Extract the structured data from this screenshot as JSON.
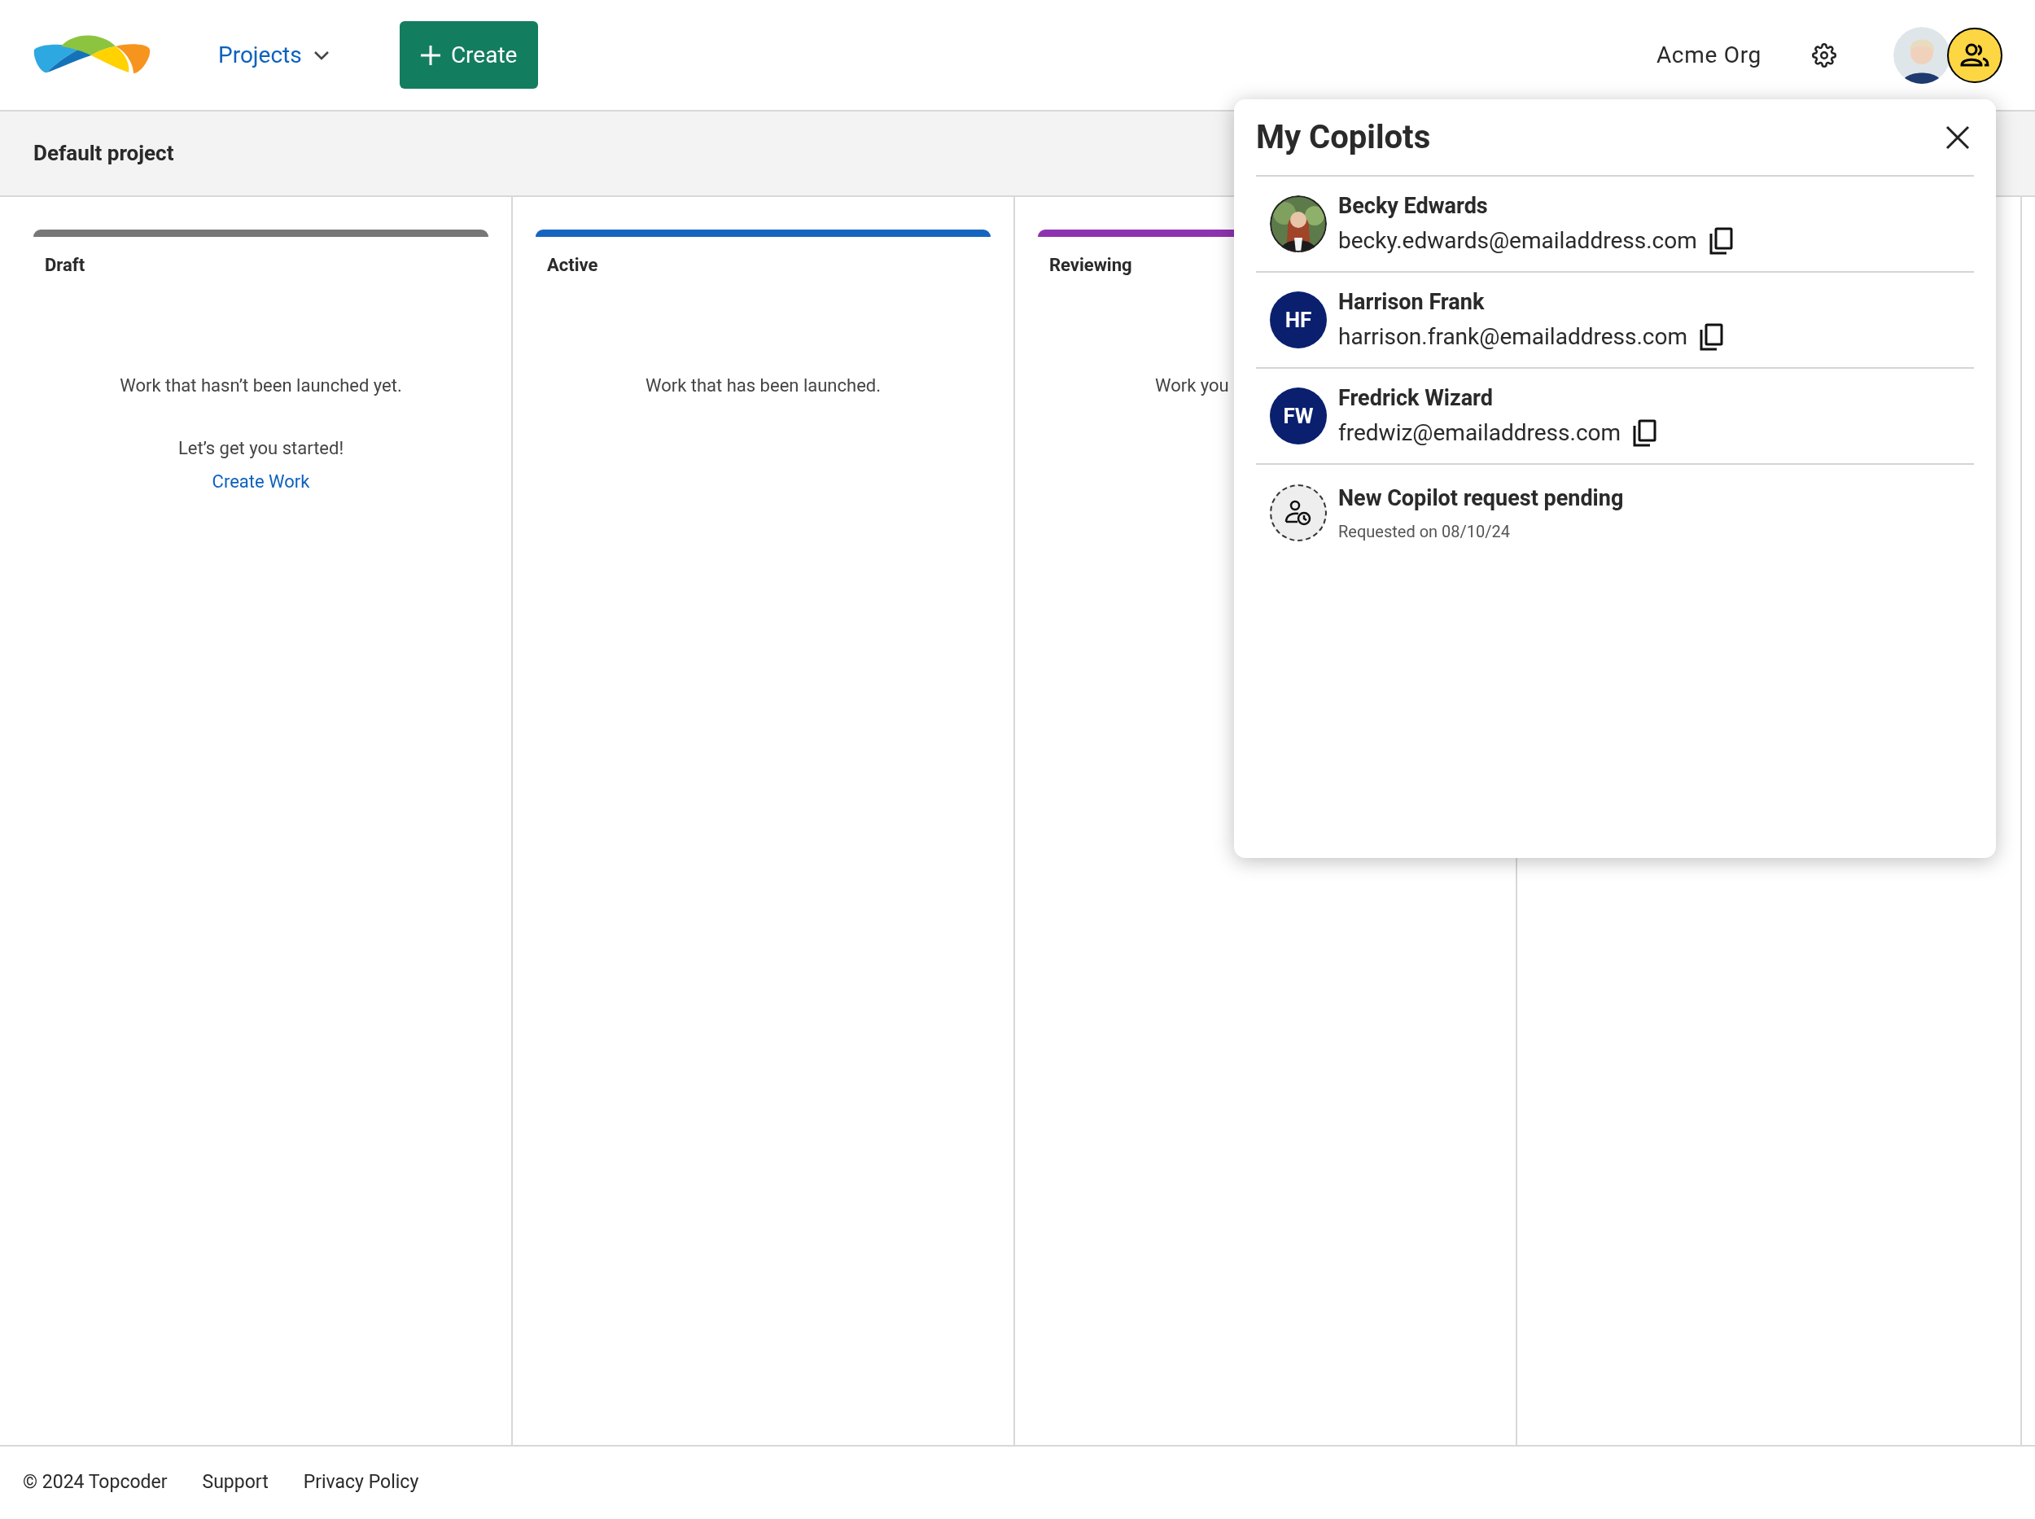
{
  "header": {
    "nav": {
      "label": "Projects"
    },
    "create_button": {
      "label": "Create"
    },
    "org": "Acme Org"
  },
  "project": {
    "title": "Default project"
  },
  "columns": [
    {
      "title": "Draft",
      "color": "#777777",
      "description": "Work that hasn’t been launched yet.",
      "prompt": "Let’s get you started!",
      "link": "Create Work"
    },
    {
      "title": "Active",
      "color": "#1565c0",
      "description": "Work that has been launched."
    },
    {
      "title": "Reviewing",
      "color": "#8e33b0",
      "description": "Work you",
      "cut_off": true
    }
  ],
  "copilots_panel": {
    "title": "My Copilots",
    "items": [
      {
        "name": "Becky Edwards",
        "email": "becky.edwards@emailaddress.com"
      },
      {
        "kind": "initials",
        "initials": "HF",
        "name": "Harrison Frank",
        "email": "harrison.frank@emailaddress.com"
      },
      {
        "kind": "initials",
        "initials": "FW",
        "name": "Fredrick Wizard",
        "email": "fredwiz@emailaddress.com"
      },
      {
        "kind": "pending",
        "name": "New Copilot request pending",
        "note": "Requested on 08/10/24"
      }
    ]
  },
  "footer": {
    "copyright": "© 2024 Topcoder",
    "links": [
      "Support",
      "Privacy Policy"
    ]
  }
}
